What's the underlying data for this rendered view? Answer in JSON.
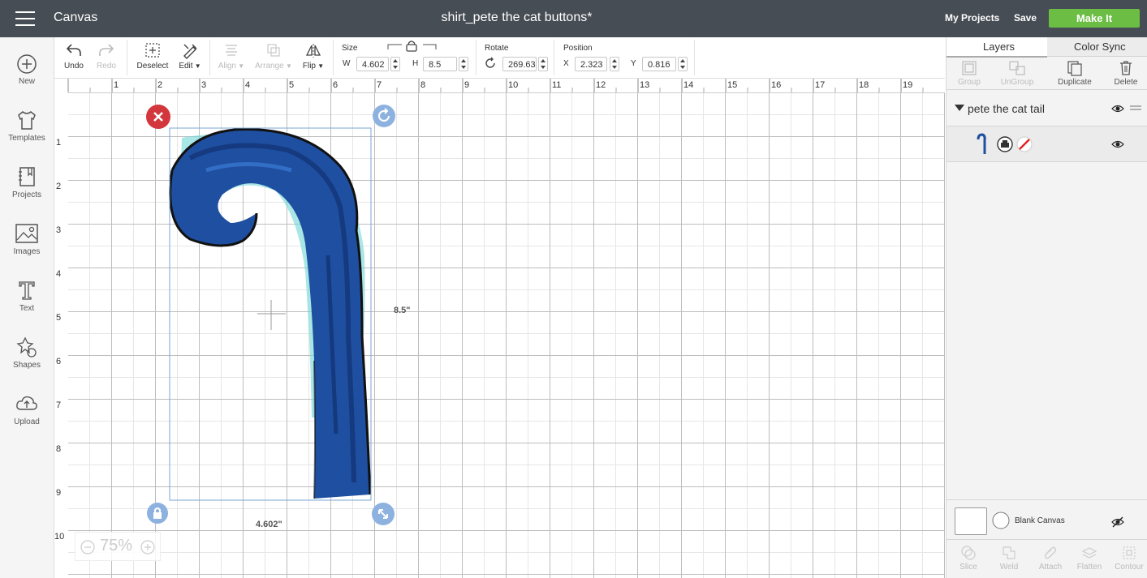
{
  "app": {
    "title": "Canvas",
    "document_title": "shirt_pete the cat buttons*"
  },
  "header": {
    "my_projects": "My Projects",
    "save": "Save",
    "make_it": "Make It"
  },
  "colors": {
    "topbar": "#474d54",
    "make_it": "#6bbd44",
    "tail_blue": "#1f4fa0"
  },
  "left_nav": [
    {
      "label": "New",
      "icon": "plus-circle-icon"
    },
    {
      "label": "Templates",
      "icon": "shirt-icon"
    },
    {
      "label": "Projects",
      "icon": "notebook-icon"
    },
    {
      "label": "Images",
      "icon": "image-icon"
    },
    {
      "label": "Text",
      "icon": "text-t-icon"
    },
    {
      "label": "Shapes",
      "icon": "shapes-icon"
    },
    {
      "label": "Upload",
      "icon": "cloud-upload-icon"
    }
  ],
  "toolbar": {
    "undo": "Undo",
    "redo": "Redo",
    "deselect": "Deselect",
    "edit": "Edit",
    "align": "Align",
    "arrange": "Arrange",
    "flip": "Flip",
    "size_label": "Size",
    "w_label": "W",
    "w_value": "4.602",
    "h_label": "H",
    "h_value": "8.5",
    "rotate_label": "Rotate",
    "rotate_value": "269.63",
    "position_label": "Position",
    "x_label": "X",
    "x_value": "2.323",
    "y_label": "Y",
    "y_value": "0.816"
  },
  "ruler": {
    "top": [
      "1",
      "2",
      "3",
      "4",
      "5",
      "6",
      "7",
      "8",
      "9",
      "10",
      "11",
      "12",
      "13",
      "14",
      "15",
      "16",
      "17",
      "18",
      "19"
    ],
    "left": [
      "1",
      "2",
      "3",
      "4",
      "5",
      "6",
      "7",
      "8",
      "9",
      "10"
    ]
  },
  "canvas": {
    "height_dim": "8.5\"",
    "width_dim": "4.602\"",
    "zoom": "75%"
  },
  "layers": {
    "tab_layers": "Layers",
    "tab_color_sync": "Color Sync",
    "actions": [
      "Group",
      "UnGroup",
      "Duplicate",
      "Delete"
    ],
    "group_name": "pete the cat tail",
    "blank_canvas": "Blank Canvas"
  },
  "bottom_actions": [
    "Slice",
    "Weld",
    "Attach",
    "Flatten",
    "Contour"
  ]
}
